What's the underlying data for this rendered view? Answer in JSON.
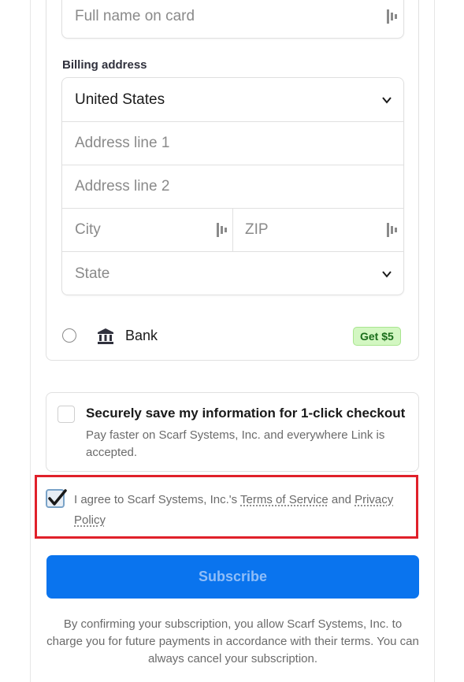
{
  "card": {
    "name_placeholder": "Full name on card"
  },
  "billing": {
    "label": "Billing address",
    "country": "United States",
    "address1_placeholder": "Address line 1",
    "address2_placeholder": "Address line 2",
    "city_placeholder": "City",
    "zip_placeholder": "ZIP",
    "state_placeholder": "State"
  },
  "payment_options": {
    "bank_label": "Bank",
    "bank_badge": "Get $5"
  },
  "link": {
    "title": "Securely save my information for 1-click checkout",
    "description": "Pay faster on Scarf Systems, Inc. and everywhere Link is accepted."
  },
  "terms": {
    "prefix": "I agree to Scarf Systems, Inc.'s ",
    "tos_label": "Terms of Service",
    "and": " and ",
    "privacy_label": "Privacy Policy",
    "checked": true
  },
  "subscribe_label": "Subscribe",
  "disclaimer": "By confirming your subscription, you allow Scarf Systems, Inc. to charge you for future payments in accordance with their terms. You can always cancel your subscription.",
  "colors": {
    "primary": "#0a74ee",
    "highlight": "#e0202a",
    "badge_bg": "#d3f7c2"
  }
}
